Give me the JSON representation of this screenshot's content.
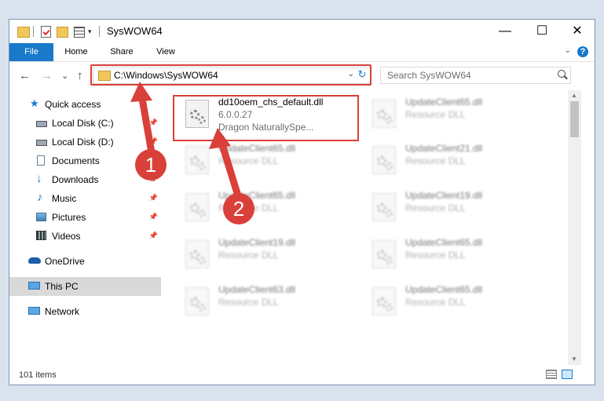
{
  "window": {
    "title": "SysWOW64",
    "minimize": "—",
    "maximize": "☐",
    "close": "✕"
  },
  "ribbon": {
    "tabs": [
      "File",
      "Home",
      "Share",
      "View"
    ],
    "help": "?",
    "expand": "⌄"
  },
  "navbar": {
    "back": "←",
    "forward": "→",
    "recent": "⌄",
    "up": "↑",
    "address": "C:\\Windows\\SysWOW64",
    "address_chevron": "⌄",
    "refresh": "↻",
    "search_placeholder": "Search SysWOW64"
  },
  "nav": {
    "items": [
      {
        "label": "Quick access",
        "icon": "star-icon",
        "pinned": false
      },
      {
        "label": "Local Disk (C:)",
        "icon": "drive-icon",
        "pinned": true
      },
      {
        "label": "Local Disk (D:)",
        "icon": "drive-icon",
        "pinned": true
      },
      {
        "label": "Documents",
        "icon": "documents-icon",
        "pinned": true
      },
      {
        "label": "Downloads",
        "icon": "download-icon",
        "pinned": true
      },
      {
        "label": "Music",
        "icon": "music-icon",
        "pinned": true
      },
      {
        "label": "Pictures",
        "icon": "pictures-icon",
        "pinned": true
      },
      {
        "label": "Videos",
        "icon": "videos-icon",
        "pinned": true
      },
      {
        "label": "OneDrive",
        "icon": "cloud-icon",
        "pinned": false
      },
      {
        "label": "This PC",
        "icon": "computer-icon",
        "pinned": false
      },
      {
        "label": "Network",
        "icon": "network-icon",
        "pinned": false
      }
    ],
    "pin_glyph": "📌"
  },
  "files": [
    {
      "name": "dd10oem_chs_default.dll",
      "line2": "6.0.0.27",
      "line3": "Dragon NaturallySpe..."
    },
    {
      "name": "UpdateClient65.dll",
      "line2": "Resource DLL"
    },
    {
      "name": "UpdateClient65.dll",
      "line2": "Resource DLL"
    },
    {
      "name": "UpdateClient21.dll",
      "line2": "Resource DLL"
    },
    {
      "name": "UpdateClient65.dll",
      "line2": "Resource DLL"
    },
    {
      "name": "UpdateClient19.dll",
      "line2": "Resource DLL"
    },
    {
      "name": "UpdateClient19.dll",
      "line2": "Resource DLL"
    },
    {
      "name": "UpdateClient65.dll",
      "line2": "Resource DLL"
    },
    {
      "name": "UpdateClient63.dll",
      "line2": "Resource DLL"
    },
    {
      "name": "UpdateClient65.dll",
      "line2": "Resource DLL"
    }
  ],
  "status": {
    "count": "101 items"
  },
  "annotations": {
    "badge1": "1",
    "badge2": "2"
  },
  "colors": {
    "accent": "#1979ca",
    "highlight": "#d9403a",
    "selection": "#cce8ff"
  }
}
